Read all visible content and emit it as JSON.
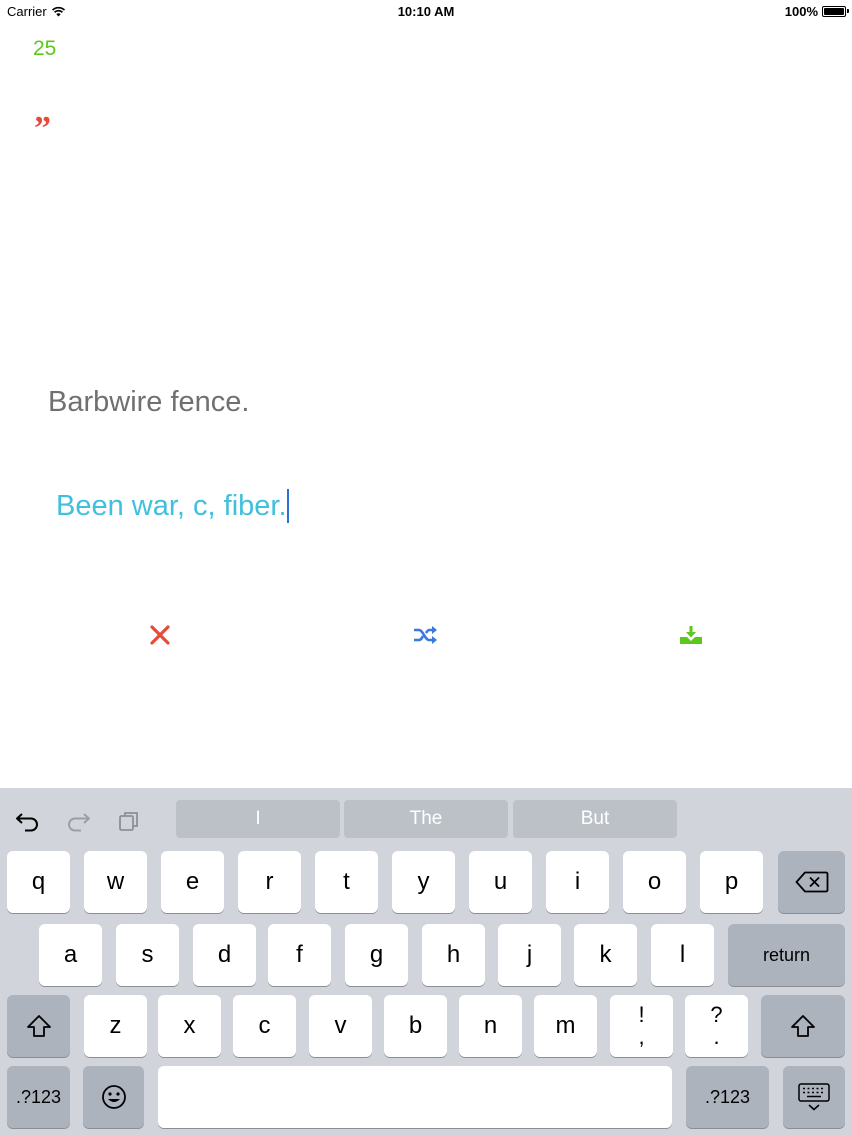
{
  "status_bar": {
    "carrier": "Carrier",
    "time": "10:10 AM",
    "battery": "100%"
  },
  "quiz": {
    "count": "25",
    "quote_mark": "”",
    "prompt": "Barbwire fence.",
    "answer": "Been war, c, fiber."
  },
  "actions": {
    "cancel_icon": "close-icon",
    "shuffle_icon": "shuffle-icon",
    "save_icon": "download-icon",
    "colors": {
      "cancel": "#e84a3a",
      "shuffle": "#3b78e0",
      "save": "#5cc81e"
    }
  },
  "keyboard": {
    "suggestions": [
      "I",
      "The",
      "But"
    ],
    "row1": [
      "q",
      "w",
      "e",
      "r",
      "t",
      "y",
      "u",
      "i",
      "o",
      "p"
    ],
    "row2": [
      "a",
      "s",
      "d",
      "f",
      "g",
      "h",
      "j",
      "k",
      "l"
    ],
    "row3": [
      "z",
      "x",
      "c",
      "v",
      "b",
      "n",
      "m"
    ],
    "punct1": {
      "top": "!",
      "bottom": ","
    },
    "punct2": {
      "top": "?",
      "bottom": "."
    },
    "return_label": "return",
    "numbers_label": ".?123"
  }
}
